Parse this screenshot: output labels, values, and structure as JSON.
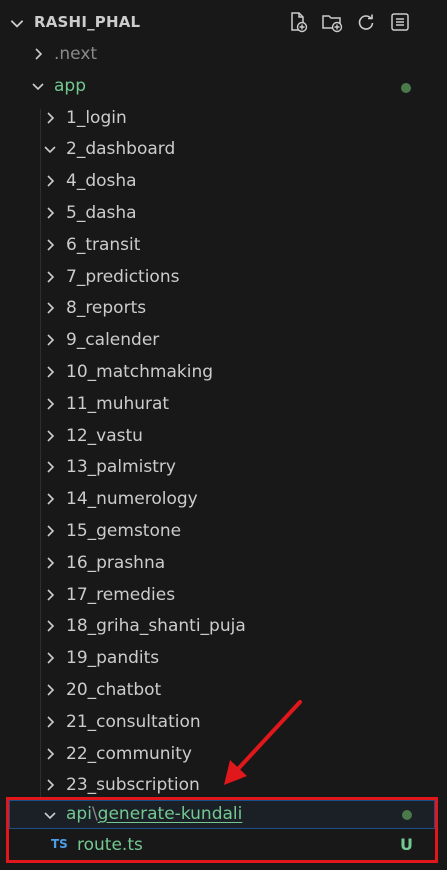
{
  "explorer": {
    "title": "RASHI_PHAL",
    "header_icons": [
      "new-file-icon",
      "new-folder-icon",
      "refresh-icon",
      "collapse-all-icon"
    ]
  },
  "tree": {
    "next_label": ".next",
    "app_label": "app",
    "folders": [
      {
        "label": "1_login",
        "expanded": false
      },
      {
        "label": "2_dashboard",
        "expanded": true
      },
      {
        "label": "4_dosha",
        "expanded": false
      },
      {
        "label": "5_dasha",
        "expanded": false
      },
      {
        "label": "6_transit",
        "expanded": false
      },
      {
        "label": "7_predictions",
        "expanded": false
      },
      {
        "label": "8_reports",
        "expanded": false
      },
      {
        "label": "9_calender",
        "expanded": false
      },
      {
        "label": "10_matchmaking",
        "expanded": false
      },
      {
        "label": "11_muhurat",
        "expanded": false
      },
      {
        "label": "12_vastu",
        "expanded": false
      },
      {
        "label": "13_palmistry",
        "expanded": false
      },
      {
        "label": "14_numerology",
        "expanded": false
      },
      {
        "label": "15_gemstone",
        "expanded": false
      },
      {
        "label": "16_prashna",
        "expanded": false
      },
      {
        "label": "17_remedies",
        "expanded": false
      },
      {
        "label": "18_griha_shanti_puja",
        "expanded": false
      },
      {
        "label": "19_pandits",
        "expanded": false
      },
      {
        "label": "20_chatbot",
        "expanded": false
      },
      {
        "label": "21_consultation",
        "expanded": false
      },
      {
        "label": "22_community",
        "expanded": false
      },
      {
        "label": "23_subscription",
        "expanded": false
      }
    ],
    "api_folder": {
      "segment1": "api",
      "separator": "\\",
      "segment2": "generate-kundali"
    },
    "route_file": {
      "icon_text": "TS",
      "label": "route.ts",
      "status": "U"
    }
  },
  "colors": {
    "background": "#181818",
    "untracked_green": "#73c991",
    "highlight_red": "#e0171b",
    "ts_blue": "#4d9ee8"
  }
}
